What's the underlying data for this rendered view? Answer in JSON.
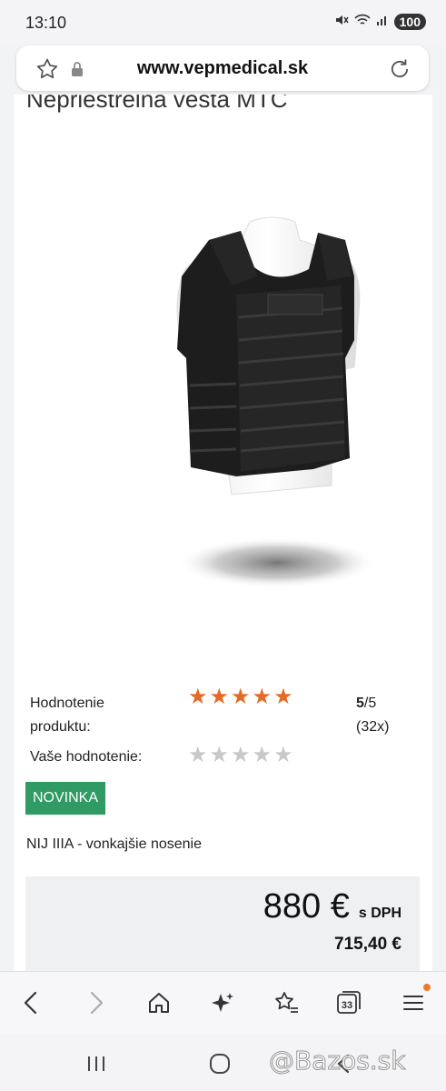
{
  "status_bar": {
    "time": "13:10",
    "battery": "100"
  },
  "browser": {
    "url": "www.vepmedical.sk",
    "tab_count": "33"
  },
  "product": {
    "title": "Nepriestrelná vesta MTC",
    "rating_label": "Hodnotenie produktu:",
    "rating_value": 5,
    "rating_score": "5",
    "rating_max": "/5",
    "rating_count": "(32x)",
    "your_rating_label": "Vaše hodnotenie:",
    "your_rating_value": 0,
    "badge": "NOVINKA",
    "short_description": "NIJ IIIA - vonkajšie nosenie",
    "price": "880 €",
    "price_suffix": "s DPH",
    "price_without_vat": "715,40 €"
  },
  "colors": {
    "star_on": "#e56a25",
    "star_off": "#c8c8c8",
    "badge_bg": "#2f9a63",
    "menu_dot": "#f07a2a"
  },
  "toolbar": {
    "icons": [
      "back-icon",
      "forward-icon",
      "home-icon",
      "ai-sparkle-icon",
      "bookmark-star-icon",
      "tabs-icon",
      "menu-icon"
    ]
  },
  "navbar": {
    "icons": [
      "recent-apps-icon",
      "home-circle-icon",
      "back-arrow-icon"
    ]
  },
  "watermark": "@Bazos.sk"
}
